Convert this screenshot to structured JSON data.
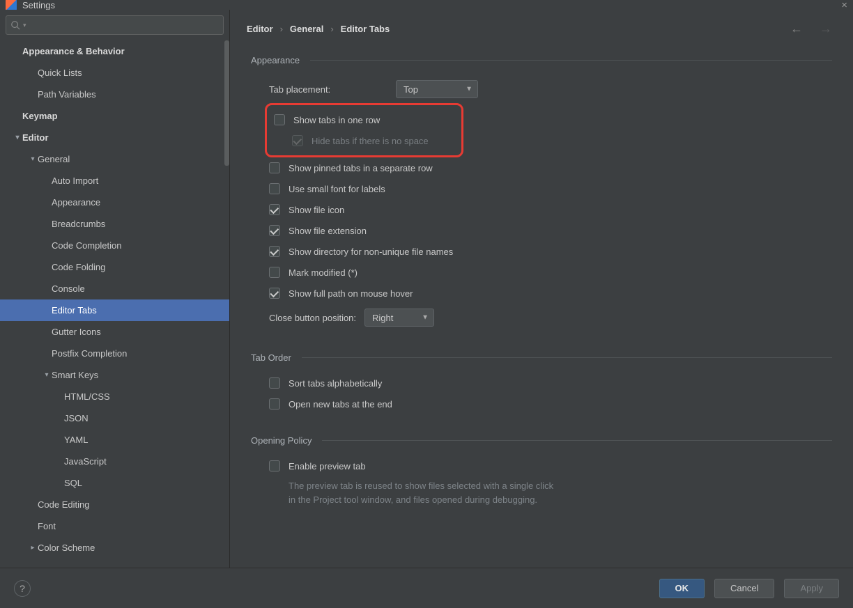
{
  "window": {
    "title": "Settings"
  },
  "search": {
    "placeholder": ""
  },
  "tree": [
    {
      "label": "Appearance & Behavior",
      "indent": 32,
      "bold": true
    },
    {
      "label": "Quick Lists",
      "indent": 54
    },
    {
      "label": "Path Variables",
      "indent": 54
    },
    {
      "label": "Keymap",
      "indent": 32,
      "bold": true
    },
    {
      "label": "Editor",
      "indent": 32,
      "bold": true,
      "exp": "v"
    },
    {
      "label": "General",
      "indent": 54,
      "exp": "v"
    },
    {
      "label": "Auto Import",
      "indent": 74
    },
    {
      "label": "Appearance",
      "indent": 74
    },
    {
      "label": "Breadcrumbs",
      "indent": 74
    },
    {
      "label": "Code Completion",
      "indent": 74
    },
    {
      "label": "Code Folding",
      "indent": 74
    },
    {
      "label": "Console",
      "indent": 74
    },
    {
      "label": "Editor Tabs",
      "indent": 74,
      "selected": true
    },
    {
      "label": "Gutter Icons",
      "indent": 74
    },
    {
      "label": "Postfix Completion",
      "indent": 74
    },
    {
      "label": "Smart Keys",
      "indent": 74,
      "exp": "v"
    },
    {
      "label": "HTML/CSS",
      "indent": 92
    },
    {
      "label": "JSON",
      "indent": 92
    },
    {
      "label": "YAML",
      "indent": 92
    },
    {
      "label": "JavaScript",
      "indent": 92
    },
    {
      "label": "SQL",
      "indent": 92
    },
    {
      "label": "Code Editing",
      "indent": 54
    },
    {
      "label": "Font",
      "indent": 54
    },
    {
      "label": "Color Scheme",
      "indent": 54,
      "exp": ">"
    }
  ],
  "breadcrumb": [
    "Editor",
    "General",
    "Editor Tabs"
  ],
  "sections": {
    "appearance": {
      "title": "Appearance",
      "tab_placement_label": "Tab placement:",
      "tab_placement_value": "Top",
      "show_tabs_one_row": "Show tabs in one row",
      "hide_tabs_no_space": "Hide tabs if there is no space",
      "show_pinned_separate": "Show pinned tabs in a separate row",
      "use_small_font": "Use small font for labels",
      "show_file_icon": "Show file icon",
      "show_file_extension": "Show file extension",
      "show_directory_nonunique": "Show directory for non-unique file names",
      "mark_modified": "Mark modified (*)",
      "show_full_path_hover": "Show full path on mouse hover",
      "close_btn_pos_label": "Close button position:",
      "close_btn_pos_value": "Right"
    },
    "tab_order": {
      "title": "Tab Order",
      "sort_alpha": "Sort tabs alphabetically",
      "open_new_end": "Open new tabs at the end"
    },
    "opening_policy": {
      "title": "Opening Policy",
      "enable_preview": "Enable preview tab",
      "preview_help1": "The preview tab is reused to show files selected with a single click",
      "preview_help2": "in the Project tool window, and files opened during debugging."
    }
  },
  "footer": {
    "ok": "OK",
    "cancel": "Cancel",
    "apply": "Apply"
  }
}
